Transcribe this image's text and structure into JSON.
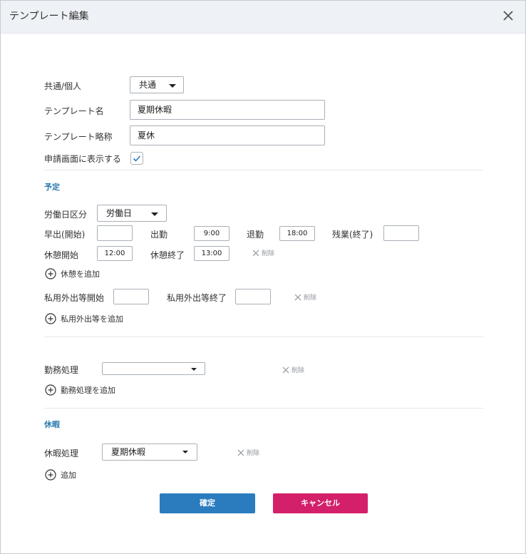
{
  "dialog": {
    "title": "テンプレート編集"
  },
  "form": {
    "shared_label": "共通/個人",
    "shared_value": "共通",
    "template_name_label": "テンプレート名",
    "template_name_value": "夏期休暇",
    "template_abbr_label": "テンプレート略称",
    "template_abbr_value": "夏休",
    "show_on_screen_label": "申請画面に表示する",
    "show_on_screen_checked": true
  },
  "schedule": {
    "section_title": "予定",
    "workday_type_label": "労働日区分",
    "workday_type_value": "労働日",
    "early_start_label": "早出(開始)",
    "early_start_value": "",
    "clock_in_label": "出勤",
    "clock_in_value": "9:00",
    "clock_out_label": "退勤",
    "clock_out_value": "18:00",
    "overtime_end_label": "残業(終了)",
    "overtime_end_value": "",
    "break_start_label": "休憩開始",
    "break_start_value": "12:00",
    "break_end_label": "休憩終了",
    "break_end_value": "13:00",
    "delete_label": "削除",
    "add_break_label": "休憩を追加",
    "private_out_start_label": "私用外出等開始",
    "private_out_start_value": "",
    "private_out_end_label": "私用外出等終了",
    "private_out_end_value": "",
    "add_private_out_label": "私用外出等を追加"
  },
  "attendance": {
    "processing_label": "勤務処理",
    "processing_value": "",
    "delete_label": "削除",
    "add_label": "勤務処理を追加"
  },
  "vacation": {
    "section_title": "休暇",
    "processing_label": "休暇処理",
    "processing_value": "夏期休暇",
    "delete_label": "削除",
    "add_label": "追加"
  },
  "buttons": {
    "confirm_label": "確定",
    "cancel_label": "キャンセル"
  },
  "colors": {
    "accent_blue": "#2a7cbf",
    "cancel_pink": "#d41f6a",
    "section_title": "#2a7ab0"
  }
}
